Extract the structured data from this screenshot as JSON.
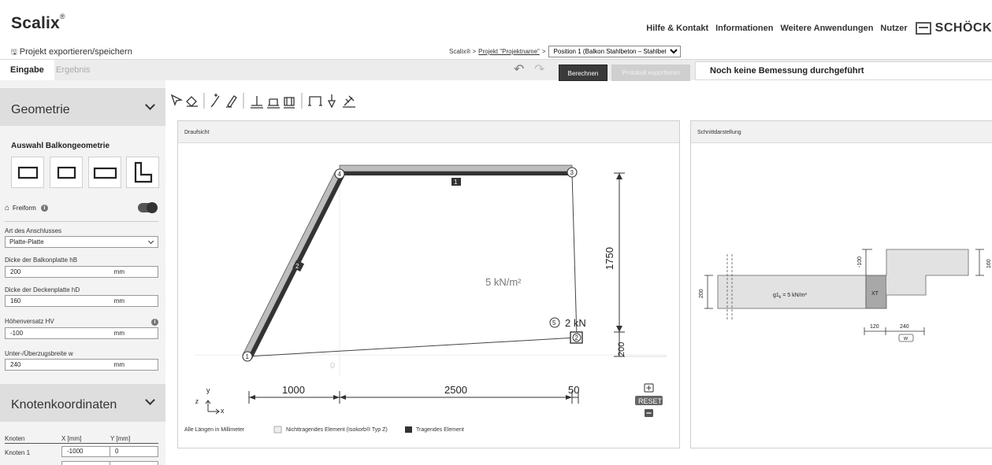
{
  "app": {
    "logo": "Scalix",
    "logo_mark": "®"
  },
  "topnav": {
    "items": [
      "Hilfe & Kontakt",
      "Informationen",
      "Weitere Anwendungen",
      "Nutzer"
    ],
    "brand": "SCHÖCK"
  },
  "export_link": "Projekt exportieren/speichern",
  "breadcrumb": {
    "root": "Scalix® >",
    "project": "Projekt \"Projektname\"",
    "sep": ">",
    "position_select": "Position 1 (Balkon Stahlbeton – Stahlbeton)"
  },
  "tabs": [
    "Eingabe",
    "Ergebnis"
  ],
  "actions": {
    "undo": "↶",
    "redo": "↷",
    "calculate": "Berechnen",
    "export_protocol": "Protokoll exportieren",
    "status": "Noch keine Bemessung durchgeführt"
  },
  "sidebar": {
    "geometry": {
      "title": "Geometrie",
      "subtitle": "Auswahl Balkongeometrie",
      "freeform_label": "Freiform",
      "connection_label": "Art des Anschlusses",
      "connection_value": "Platte-Platte",
      "fields": [
        {
          "label": "Dicke der Balkonplatte hB",
          "value": "200",
          "unit": "mm"
        },
        {
          "label": "Dicke der Deckenplatte hD",
          "value": "160",
          "unit": "mm"
        },
        {
          "label": "Höhenversatz HV",
          "value": "-100",
          "unit": "mm"
        },
        {
          "label": "Unter-/Überzugsbreite w",
          "value": "240",
          "unit": "mm"
        }
      ]
    },
    "nodes": {
      "title": "Knotenkoordinaten",
      "headers": [
        "Knoten",
        "X [mm]",
        "Y [mm]"
      ],
      "rows": [
        {
          "name": "Knoten 1",
          "x": "-1000",
          "y": "0"
        }
      ]
    }
  },
  "drawing": {
    "panel_title": "Draufsicht",
    "load_area": "5 kN/m²",
    "point_load_id": "5",
    "point_load": "2 kN",
    "dim_vertical": "1750",
    "dim_vertical_small": "200",
    "dim_h": [
      "1000",
      "2500",
      "50"
    ],
    "origin": "0",
    "node_labels": [
      "1",
      "2",
      "3",
      "4"
    ],
    "element_labels": [
      "1",
      "2"
    ],
    "axis_x": "x",
    "axis_y": "y",
    "reset": "RESET",
    "legend_note": "Alle Längen in Millimeter",
    "legend_nonbearing": "Nichttragendes Element (Isokorb® Typ Z)",
    "legend_bearing": "Tragendes Element"
  },
  "section": {
    "panel_title": "Schnittdarstellung",
    "load": "g1",
    "load_sub": "k",
    "load_val": " = 5 kN/m²",
    "xt": "XT",
    "dim_200": "200",
    "dim_100": "-100",
    "dim_160": "160",
    "dim_120": "120",
    "dim_240": "240",
    "w": "w"
  }
}
